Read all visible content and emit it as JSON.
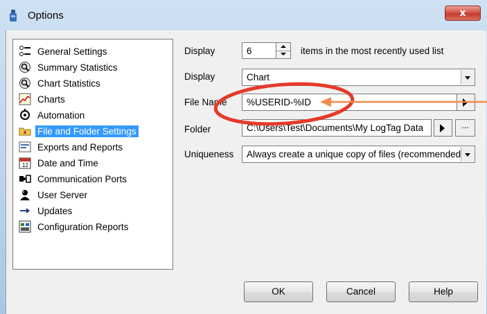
{
  "window": {
    "title": "Options",
    "close_symbol": "x"
  },
  "nav": {
    "items": [
      {
        "label": "General Settings",
        "icon": "general-settings-icon"
      },
      {
        "label": "Summary Statistics",
        "icon": "summary-statistics-icon"
      },
      {
        "label": "Chart Statistics",
        "icon": "chart-statistics-icon"
      },
      {
        "label": "Charts",
        "icon": "charts-icon"
      },
      {
        "label": "Automation",
        "icon": "automation-icon"
      },
      {
        "label": "File and Folder Settings",
        "icon": "folder-icon",
        "selected": true
      },
      {
        "label": "Exports and Reports",
        "icon": "exports-icon"
      },
      {
        "label": "Date and Time",
        "icon": "calendar-icon"
      },
      {
        "label": "Communication Ports",
        "icon": "ports-icon"
      },
      {
        "label": "User Server",
        "icon": "user-server-icon"
      },
      {
        "label": "Updates",
        "icon": "arrow-right-icon"
      },
      {
        "label": "Configuration Reports",
        "icon": "configuration-reports-icon"
      }
    ]
  },
  "form": {
    "display_label": "Display",
    "recent_count": "6",
    "recent_suffix": "items in the most recently used list",
    "display2_label": "Display",
    "display2_value": "Chart",
    "filename_label": "File Name",
    "filename_value": "%USERID-%ID",
    "folder_label": "Folder",
    "folder_value": "C:\\Users\\Test\\Documents\\My LogTag Data",
    "folder_browse_label": "...",
    "uniqueness_label": "Uniqueness",
    "uniqueness_value": "Always create a unique copy of files (recommended)"
  },
  "buttons": {
    "ok": "OK",
    "cancel": "Cancel",
    "help": "Help"
  },
  "colors": {
    "selection": "#3399ff",
    "annotation_ellipse": "#e53a2a",
    "annotation_arrow": "#f08a4b"
  }
}
